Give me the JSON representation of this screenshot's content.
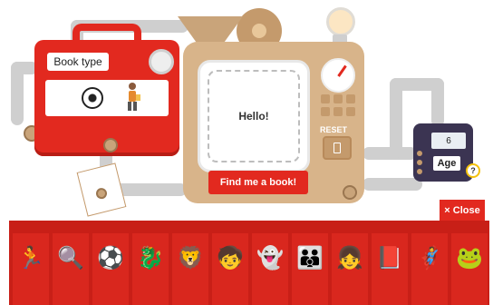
{
  "book_type": {
    "label": "Book type",
    "selected": [
      "soccer-ball-icon",
      "kid-character-icon"
    ]
  },
  "main_screen": {
    "message": "Hello!"
  },
  "controls": {
    "reset_label": "RESET",
    "find_button_label": "Find me a book!"
  },
  "age": {
    "value": "6",
    "label": "Age",
    "help_symbol": "?"
  },
  "tray": {
    "close_label": "× Close",
    "items": [
      {
        "name": "runner-icon",
        "glyph": "🏃"
      },
      {
        "name": "magnifier-icon",
        "glyph": "🔍"
      },
      {
        "name": "ball-icon",
        "glyph": "⚽"
      },
      {
        "name": "dragon-icon",
        "glyph": "🐉"
      },
      {
        "name": "lion-icon",
        "glyph": "🦁"
      },
      {
        "name": "kid-sign-icon",
        "glyph": "🧒"
      },
      {
        "name": "ghost-icon",
        "glyph": "👻"
      },
      {
        "name": "family-icon",
        "glyph": "👪"
      },
      {
        "name": "girl-icon",
        "glyph": "👧"
      },
      {
        "name": "book-icon",
        "glyph": "📕"
      },
      {
        "name": "hero-icon",
        "glyph": "🦸"
      },
      {
        "name": "frog-icon",
        "glyph": "🐸"
      }
    ]
  },
  "colors": {
    "accent_red": "#e2291f",
    "machine_tan": "#d8b48a",
    "age_machine": "#3b3452"
  }
}
